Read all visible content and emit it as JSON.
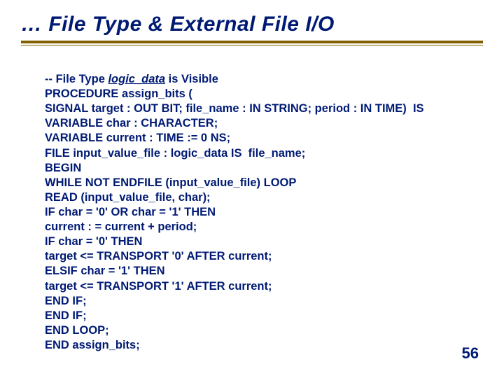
{
  "title": "… File Type & External File I/O",
  "page_number": "56",
  "code": {
    "l1_a": "-- File Type ",
    "l1_b": "logic_data",
    "l1_c": " is Visible",
    "l2_a": "PROCEDURE",
    "l2_b": " assign_bits (",
    "l3_a": "SIGNAL",
    "l3_b": " target : ",
    "l3_c": "OUT",
    "l3_d": " BIT; file_name : ",
    "l3_e": "IN",
    "l3_f": " STRING; period : ",
    "l3_g": "IN",
    "l3_h": " TIME)  ",
    "l3_i": "IS",
    "l4_a": "VARIABLE",
    "l4_b": " char : CHARACTER;",
    "l5_a": "VARIABLE",
    "l5_b": " current : TIME := 0 NS;",
    "l6_a": "FILE",
    "l6_b": " input_value_file : logic_data ",
    "l6_c": "IS",
    "l6_d": "  file_name;",
    "l7_a": "BEGIN",
    "l8_a": "WHILE NOT ENDFILE",
    "l8_b": " (input_value_file) ",
    "l8_c": "LOOP",
    "l9_a": "READ",
    "l9_b": " (input_value_file, char);",
    "l10_a": "IF",
    "l10_b": " char = '0' ",
    "l10_c": "OR",
    "l10_d": " char = '1' ",
    "l10_e": "THEN",
    "l11": "current : = current + period;",
    "l12_a": "IF",
    "l12_b": " char = '0' ",
    "l12_c": "THEN",
    "l13_a": "target <= ",
    "l13_b": "TRANSPORT",
    "l13_c": " '0' ",
    "l13_d": "AFTER",
    "l13_e": " current;",
    "l14_a": "ELSIF",
    "l14_b": " char = '1' ",
    "l14_c": "THEN",
    "l15_a": "target <= ",
    "l15_b": "TRANSPORT",
    "l15_c": " '1' ",
    "l15_d": "AFTER",
    "l15_e": " current;",
    "l16": "END IF;",
    "l17": "END IF;",
    "l18": "END LOOP;",
    "l19_a": "END",
    "l19_b": " assign_bits;"
  }
}
